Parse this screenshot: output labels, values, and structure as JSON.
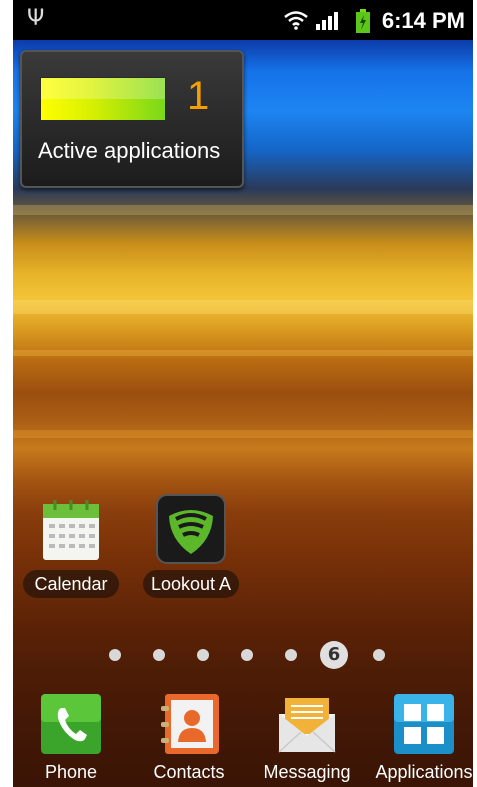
{
  "status_bar": {
    "time": "6:14 PM",
    "icons": [
      "usb-icon",
      "wifi-icon",
      "signal-icon",
      "battery-charging-icon"
    ]
  },
  "widget": {
    "count": "1",
    "label": "Active applications",
    "bar_colors": [
      "#ffff00",
      "#7ad81a"
    ]
  },
  "shortcuts": [
    {
      "label": "Calendar",
      "icon": "calendar-icon"
    },
    {
      "label": "Lookout A",
      "icon": "lookout-shield-icon"
    }
  ],
  "page_indicator": {
    "total": 7,
    "current_label": "6"
  },
  "dock": [
    {
      "label": "Phone",
      "icon": "phone-icon",
      "color": "#3aa52a"
    },
    {
      "label": "Contacts",
      "icon": "contacts-icon",
      "color": "#e8692a"
    },
    {
      "label": "Messaging",
      "icon": "messaging-icon",
      "color": "#f2b23a"
    },
    {
      "label": "Applications",
      "icon": "applications-grid-icon",
      "color": "#1a8fc8"
    }
  ]
}
